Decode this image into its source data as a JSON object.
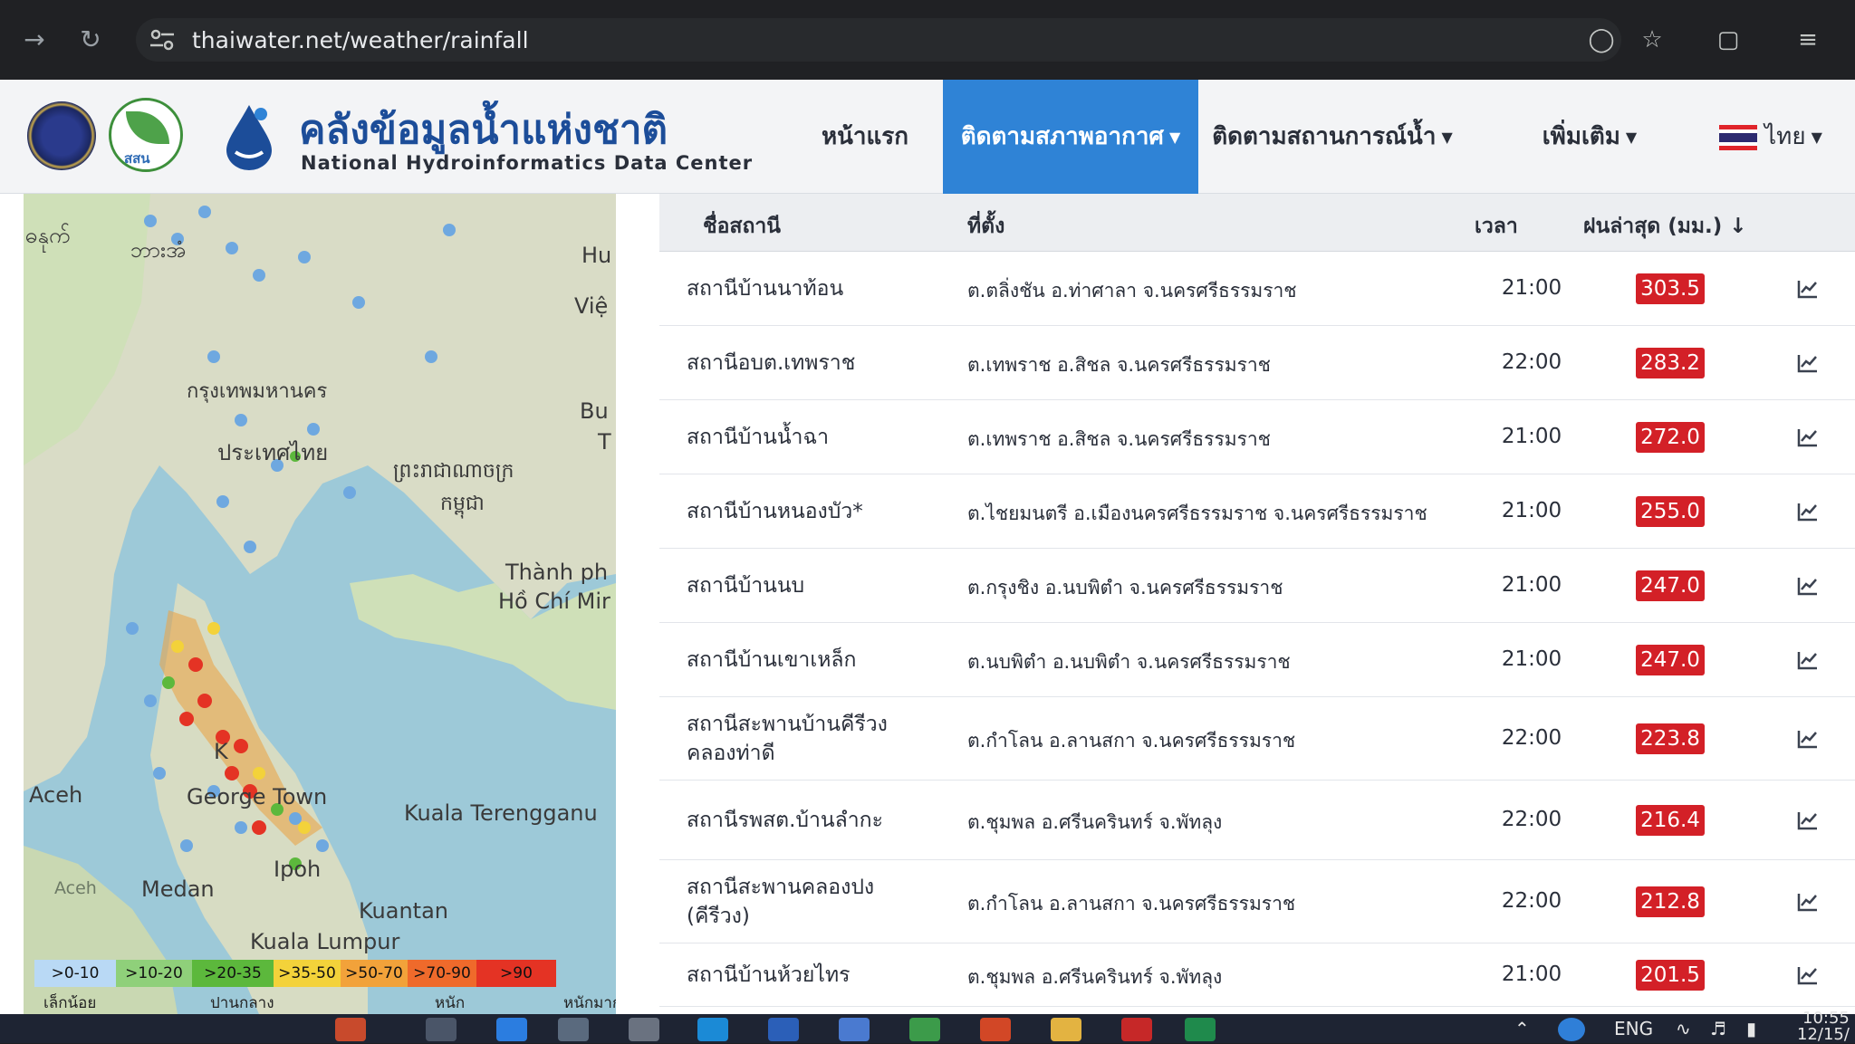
{
  "browser": {
    "url": "thaiwater.net/weather/rainfall",
    "back_icon": "arrow-left-icon",
    "reload_icon": "reload-icon"
  },
  "header": {
    "brand_th": "คลังข้อมูลน้ำแห่งชาติ",
    "brand_en": "National Hydroinformatics Data Center",
    "logo_leaf_text": "สสน",
    "menu": {
      "home": "หน้าแรก",
      "weather": "ติดตามสภาพอากาศ",
      "water": "ติดตามสถานการณ์น้ำ",
      "more": "เพิ่มเติม",
      "lang": "ไทย"
    },
    "accent_color": "#2f83d6"
  },
  "map": {
    "labels": {
      "myanmar": "ဓနုက်",
      "bago": "ဘားအံ",
      "bangkok": "กรุงเทพมหานคร",
      "thailand": "ประเทศไทย",
      "cambodia_1": "ព្រះរាជាណាចក្រ",
      "cambodia_2": "កម្ពុជា",
      "hcmc_1": "Thành ph",
      "hcmc_2": "Hồ Chí Mir",
      "hue": "Hu",
      "viet": "Việ",
      "bu": "Bu",
      "t": "T",
      "aceh": "Aceh",
      "aceh2": "Aceh",
      "george_town": "George Town",
      "k": "K",
      "kuala_terengganu": "Kuala Terengganu",
      "ipoh": "Ipoh",
      "medan": "Medan",
      "kuantan": "Kuantan",
      "kuala_lumpur": "Kuala Lumpur"
    },
    "legend": [
      {
        "label": ">0-10",
        "color": "#b9d9f5"
      },
      {
        "label": ">10-20",
        "color": "#8fd07a"
      },
      {
        "label": ">20-35",
        "color": "#5cb83c"
      },
      {
        "label": ">35-50",
        "color": "#f3d23a"
      },
      {
        "label": ">50-70",
        "color": "#f2a23a"
      },
      {
        "label": ">70-90",
        "color": "#ef6a2b"
      },
      {
        "label": ">90",
        "color": "#e43324"
      }
    ],
    "legend_labels": {
      "light": "เล็กน้อย",
      "moderate": "ปานกลาง",
      "heavy": "หนัก",
      "very_heavy": "หนักมาก"
    }
  },
  "table": {
    "headers": {
      "name": "ชื่อสถานี",
      "location": "ที่ตั้ง",
      "time": "เวลา",
      "rain": "ฝนล่าสุด (มม.)"
    },
    "sort_icon": "arrow-down-icon",
    "rows": [
      {
        "name": "สถานีบ้านนาท้อน",
        "location": "ต.ตลิ่งชัน อ.ท่าศาลา จ.นครศรีธรรมราช",
        "time": "21:00",
        "rain": "303.5"
      },
      {
        "name": "สถานีอบต.เทพราช",
        "location": "ต.เทพราช อ.สิชล จ.นครศรีธรรมราช",
        "time": "22:00",
        "rain": "283.2"
      },
      {
        "name": "สถานีบ้านน้ำฉา",
        "location": "ต.เทพราช อ.สิชล จ.นครศรีธรรมราช",
        "time": "21:00",
        "rain": "272.0"
      },
      {
        "name": "สถานีบ้านหนองบัว*",
        "location": "ต.ไชยมนตรี อ.เมืองนครศรีธรรมราช จ.นครศรีธรรมราช",
        "time": "21:00",
        "rain": "255.0"
      },
      {
        "name": "สถานีบ้านนบ",
        "location": "ต.กรุงชิง อ.นบพิตำ จ.นครศรีธรรมราช",
        "time": "21:00",
        "rain": "247.0"
      },
      {
        "name": "สถานีบ้านเขาเหล็ก",
        "location": "ต.นบพิตำ อ.นบพิตำ จ.นครศรีธรรมราช",
        "time": "21:00",
        "rain": "247.0"
      },
      {
        "name": "สถานีสะพานบ้านคีรีวงคลองท่าดี",
        "location": "ต.กำโลน อ.ลานสกา จ.นครศรีธรรมราช",
        "time": "22:00",
        "rain": "223.8"
      },
      {
        "name": "สถานีรพสต.บ้านลำกะ",
        "location": "ต.ชุมพล อ.ศรีนครินทร์ จ.พัทลุง",
        "time": "22:00",
        "rain": "216.4"
      },
      {
        "name": "สถานีสะพานคลองปง (คีรีวง)",
        "location": "ต.กำโลน อ.ลานสกา จ.นครศรีธรรมราช",
        "time": "22:00",
        "rain": "212.8"
      },
      {
        "name": "สถานีบ้านห้วยไทร",
        "location": "ต.ชุมพล อ.ศรีนครินทร์ จ.พัทลุง",
        "time": "21:00",
        "rain": "201.5"
      }
    ],
    "badge_color": "#d32027",
    "row_icon": "line-chart-icon"
  },
  "taskbar": {
    "lang": "ENG",
    "time": "10:55",
    "date": "12/15/"
  }
}
